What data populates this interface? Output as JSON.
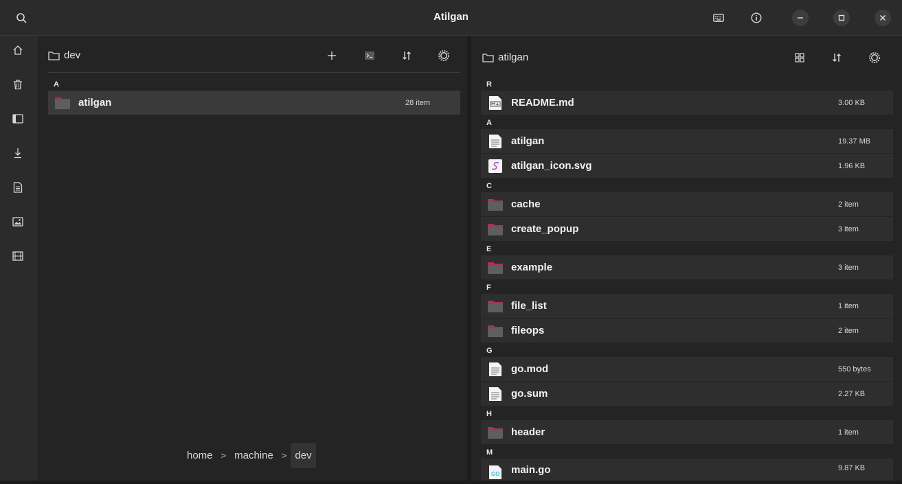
{
  "window": {
    "title": "Atilgan"
  },
  "titlebar": {
    "icons": [
      "search-icon",
      "keyboard-icon",
      "info-icon"
    ],
    "controls": [
      "minimize-icon",
      "maximize-icon",
      "close-icon"
    ]
  },
  "sidebar": {
    "items": [
      "home-icon",
      "trash-icon",
      "sidebar-icon",
      "download-icon",
      "document-icon",
      "image-icon",
      "film-icon"
    ]
  },
  "left_pane": {
    "path": "dev",
    "groups": [
      {
        "letter": "A",
        "items": [
          {
            "name": "atilgan",
            "size": "28 item",
            "kind": "folder",
            "selected": true
          }
        ]
      }
    ],
    "breadcrumb": [
      "home",
      "machine",
      "dev"
    ],
    "breadcrumb_sep": ">"
  },
  "right_pane": {
    "path": "atilgan",
    "groups": [
      {
        "letter": "R",
        "items": [
          {
            "name": "README.md",
            "size": "3.00 KB",
            "kind": "markdown"
          }
        ]
      },
      {
        "letter": "A",
        "items": [
          {
            "name": "atilgan",
            "size": "19.37 MB",
            "kind": "file"
          },
          {
            "name": "atilgan_icon.svg",
            "size": "1.96 KB",
            "kind": "svg"
          }
        ]
      },
      {
        "letter": "C",
        "items": [
          {
            "name": "cache",
            "size": "2 item",
            "kind": "folder"
          },
          {
            "name": "create_popup",
            "size": "3 item",
            "kind": "folder"
          }
        ]
      },
      {
        "letter": "E",
        "items": [
          {
            "name": "example",
            "size": "3 item",
            "kind": "folder"
          }
        ]
      },
      {
        "letter": "F",
        "items": [
          {
            "name": "file_list",
            "size": "1 item",
            "kind": "folder"
          },
          {
            "name": "fileops",
            "size": "2 item",
            "kind": "folder"
          }
        ]
      },
      {
        "letter": "G",
        "items": [
          {
            "name": "go.mod",
            "size": "550 bytes",
            "kind": "file"
          },
          {
            "name": "go.sum",
            "size": "2.27 KB",
            "kind": "file"
          }
        ]
      },
      {
        "letter": "H",
        "items": [
          {
            "name": "header",
            "size": "1 item",
            "kind": "folder"
          }
        ]
      },
      {
        "letter": "M",
        "items": [
          {
            "name": "main.go",
            "size": "9.87 KB",
            "kind": "go"
          }
        ]
      }
    ]
  },
  "colors": {
    "folder_top": "#a8344f",
    "folder_body": "#5e5e5e",
    "row_bg": "#2e2e2e",
    "row_selected": "#3a3a3a"
  }
}
